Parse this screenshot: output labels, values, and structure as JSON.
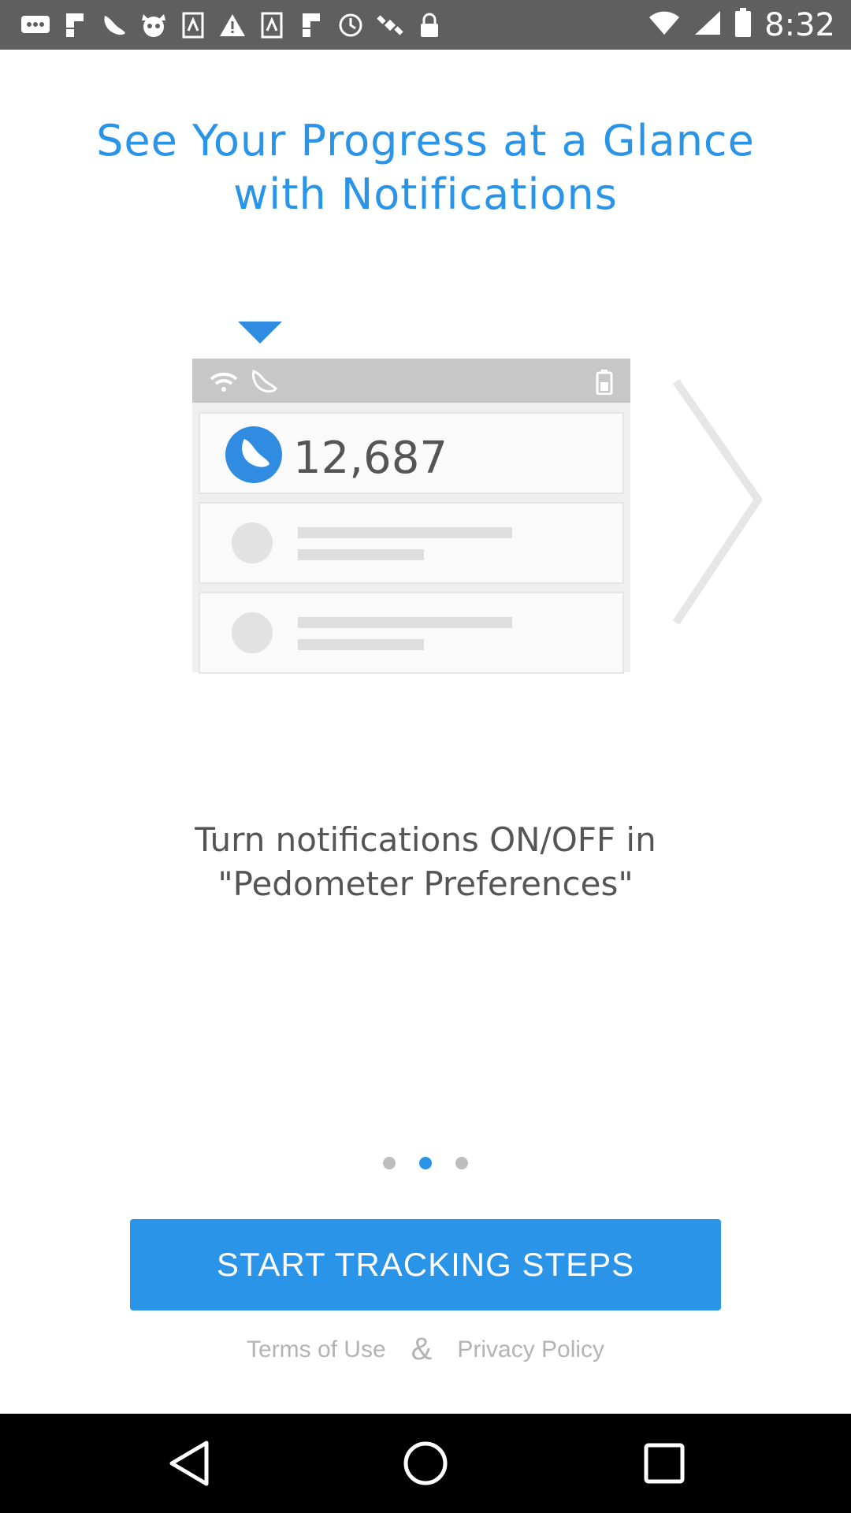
{
  "status_bar": {
    "time": "8:32",
    "icons": [
      "chat-icon",
      "flipboard-icon",
      "shoe-icon",
      "cat-icon",
      "scale-icon",
      "warning-icon",
      "scale-icon",
      "flipboard-icon",
      "sync-icon",
      "satellite-icon",
      "lock-icon"
    ]
  },
  "headline": {
    "line1": "See Your Progress at a Glance",
    "line2": "with Notifications"
  },
  "illustration": {
    "steps_value": "12,687"
  },
  "caption": {
    "line1": "Turn notifications ON/OFF in",
    "line2": "\"Pedometer Preferences\""
  },
  "pager": {
    "count": 3,
    "active_index": 1
  },
  "cta": {
    "label": "START TRACKING STEPS"
  },
  "footer": {
    "terms": "Terms of Use",
    "amp": "&",
    "privacy": "Privacy Policy"
  },
  "colors": {
    "accent": "#2a94e8",
    "status_bar": "#5f5f5f",
    "nav_bar": "#000000"
  }
}
